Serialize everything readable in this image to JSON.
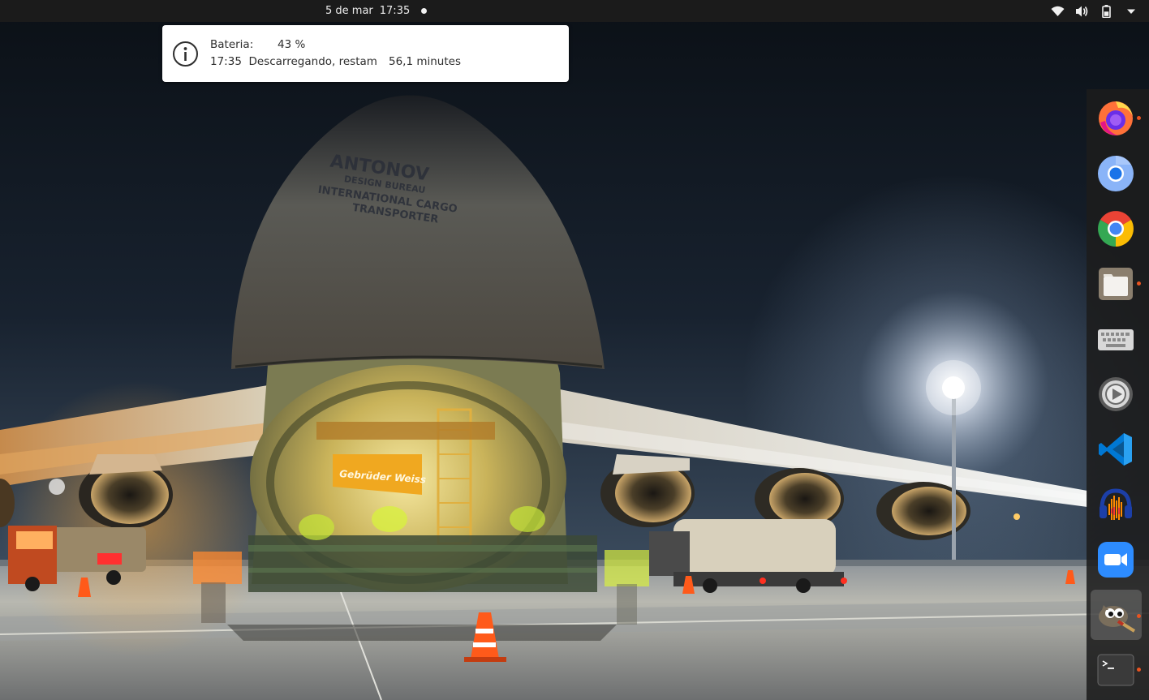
{
  "topbar": {
    "date": "5 de mar",
    "time": "17:35"
  },
  "tray_icons": [
    "wifi-icon",
    "volume-icon",
    "battery-icon",
    "system-menu-chevron-icon"
  ],
  "battery_popup": {
    "label": "Bateria:",
    "percent": "43 %",
    "time": "17:35",
    "status": "Descarregando, restam",
    "remaining": "56,1 minutes",
    "icon": "info-icon"
  },
  "wallpaper": {
    "aircraft_text": [
      "ANTONOV",
      "DESIGN BUREAU",
      "INTERNATIONAL CARGO",
      "TRANSPORTER"
    ],
    "banner_text": "Gebrüder Weiss"
  },
  "dock": {
    "items": [
      {
        "name": "firefox",
        "icon": "firefox-icon",
        "running": true
      },
      {
        "name": "chromium",
        "icon": "chromium-icon",
        "running": false
      },
      {
        "name": "google-chrome",
        "icon": "chrome-icon",
        "running": false
      },
      {
        "name": "files",
        "icon": "files-icon",
        "running": true
      },
      {
        "name": "onboard-keyboard",
        "icon": "keyboard-icon",
        "running": false
      },
      {
        "name": "settings-media",
        "icon": "settings-icon",
        "running": false
      },
      {
        "name": "vscode",
        "icon": "vscode-icon",
        "running": false
      },
      {
        "name": "audacity",
        "icon": "audacity-icon",
        "running": false
      },
      {
        "name": "zoom",
        "icon": "zoom-icon",
        "running": false
      },
      {
        "name": "gimp",
        "icon": "gimp-icon",
        "running": true
      },
      {
        "name": "terminal",
        "icon": "terminal-icon",
        "running": true
      }
    ]
  },
  "colors": {
    "topbar": "#1b1b1b",
    "running_dot": "#e95420",
    "popup_bg": "#ffffff"
  }
}
